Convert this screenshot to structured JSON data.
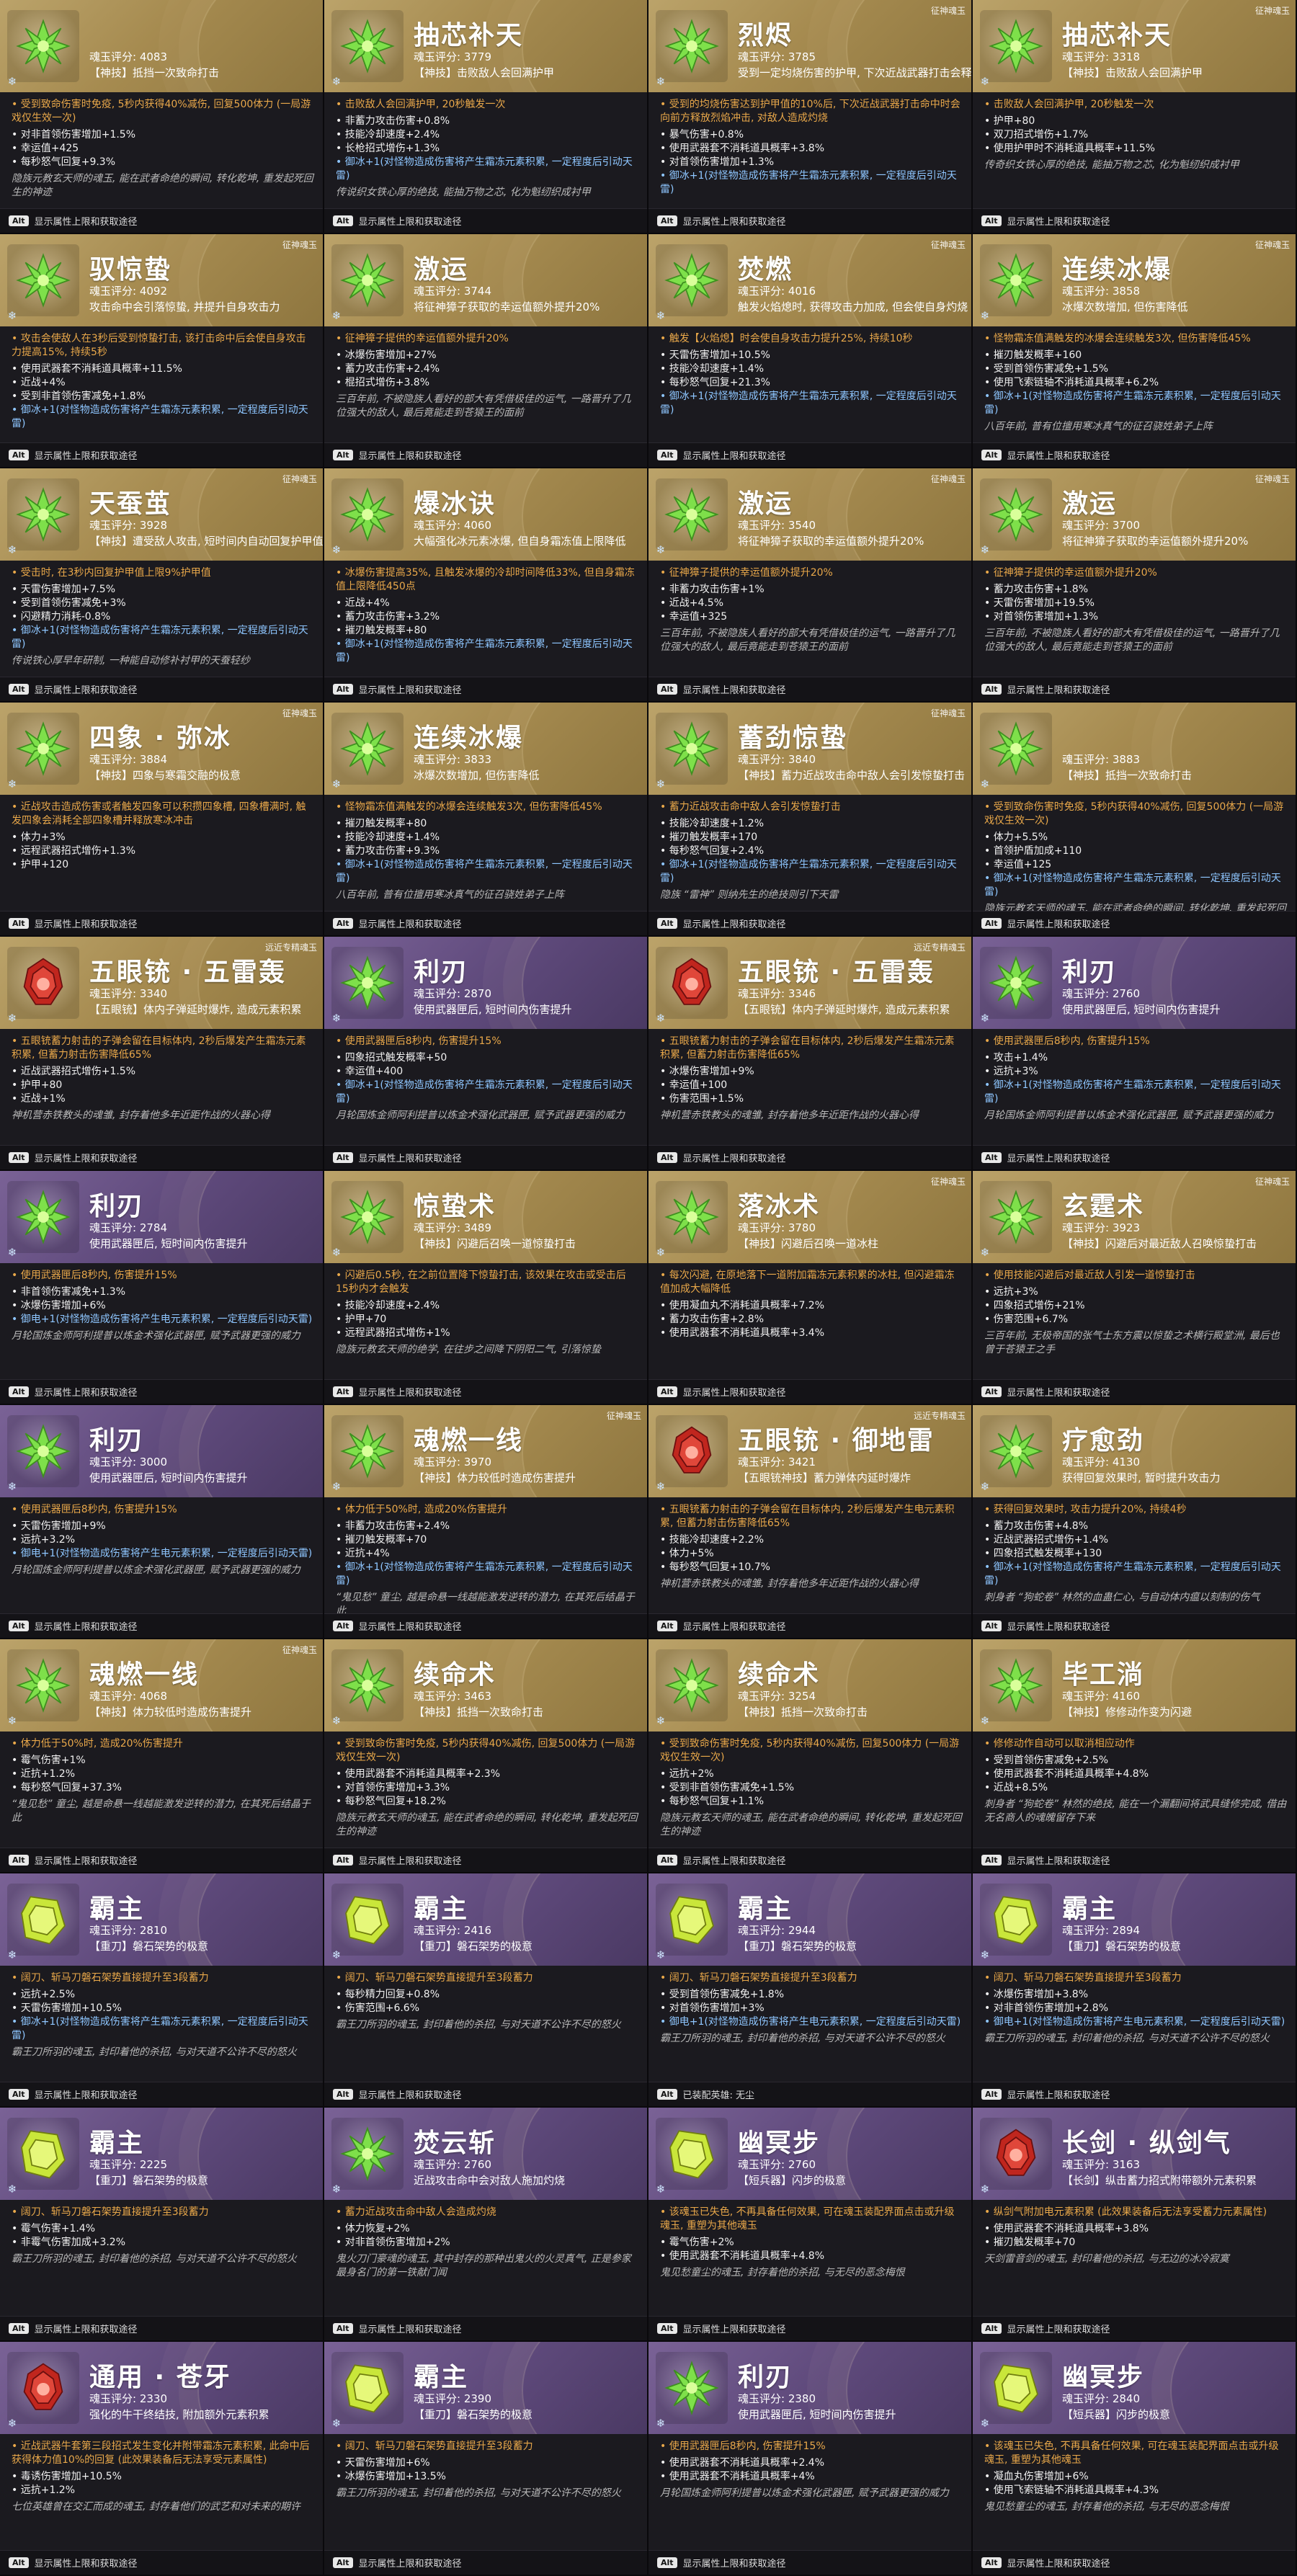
{
  "cards": [
    {
      "name": "",
      "score": "魂玉评分: 4083",
      "skill": "【神技】抵挡一次致命打击",
      "theme": "gold",
      "gem": "green",
      "tag": "",
      "orange": "• 受到致命伤害时免疫, 5秒内获得40%减伤, 回复500体力 (一局游戏仅生效一次)",
      "stats": [
        "• 对非首领伤害增加+1.5%",
        "• 幸运值+425",
        "• 每秒怒气回复+9.3%"
      ],
      "blue": "",
      "desc": "隐族元教玄天师的魂玉, 能在武者命绝的瞬间, 转化乾坤, 重发起死回生的神迹",
      "footer": "显示属性上限和获取途径"
    },
    {
      "name": "抽芯补天",
      "score": "魂玉评分: 3779",
      "skill": "【神技】击败敌人会回满护甲",
      "theme": "gold",
      "gem": "green",
      "tag": "",
      "orange": "• 击败敌人会回满护甲, 20秒触发一次",
      "stats": [
        "• 非蓄力攻击伤害+0.8%",
        "• 技能冷却速度+2.4%",
        "• 长枪招式增伤+1.3%"
      ],
      "blue": "• 御冰+1(对怪物造成伤害将产生霜冻元素积累, 一定程度后引动天雷)",
      "desc": "传说织女铁心厚的绝技, 能抽万物之芯, 化为魁纫织成衬甲",
      "footer": "显示属性上限和获取途径"
    },
    {
      "name": "烈烬",
      "score": "魂玉评分: 3785",
      "skill": "受到一定均烧伤害的护甲, 下次近战武器打击会释放烈燃",
      "theme": "gold",
      "gem": "green",
      "tag": "征神魂玉",
      "orange": "• 受到的均烧伤害达到护甲值的10%后, 下次近战武器打击命中时会向前方释放烈焰冲击, 对敌人造成灼烧",
      "stats": [
        "• 暴气伤害+0.8%",
        "• 使用武器套不消耗道具概率+3.8%",
        "• 对首领伤害增加+1.3%"
      ],
      "blue": "• 御冰+1(对怪物造成伤害将产生霜冻元素积累, 一定程度后引动天雷)",
      "desc": "",
      "footer": "显示属性上限和获取途径"
    },
    {
      "name": "抽芯补天",
      "score": "魂玉评分: 3318",
      "skill": "【神技】击败敌人会回满护甲",
      "theme": "gold",
      "gem": "green",
      "tag": "征神魂玉",
      "orange": "• 击败敌人会回满护甲, 20秒触发一次",
      "stats": [
        "• 护甲+80",
        "• 双刀招式增伤+1.7%",
        "• 使用护甲时不消耗道具概率+11.5%"
      ],
      "blue": "",
      "desc": "传奇织女铁心厚的绝技, 能抽万物之芯, 化为魁纫织成衬甲",
      "footer": "显示属性上限和获取途径"
    },
    {
      "name": "驭惊蛰",
      "score": "魂玉评分: 4092",
      "skill": "攻击命中会引落惊蛰, 并提升自身攻击力",
      "theme": "gold",
      "gem": "green",
      "tag": "征神魂玉",
      "orange": "• 攻击会使敌人在3秒后受到惊蛰打击, 该打击命中后会使自身攻击力提高15%, 持续5秒",
      "stats": [
        "• 使用武器套不消耗道具概率+11.5%",
        "• 近战+4%",
        "• 受到非首领伤害减免+1.8%"
      ],
      "blue": "• 御冰+1(对怪物造成伤害将产生霜冻元素积累, 一定程度后引动天雷)",
      "desc": "",
      "footer": "显示属性上限和获取途径"
    },
    {
      "name": "激运",
      "score": "魂玉评分: 3744",
      "skill": "将征神獐子获取的幸运值额外提升20%",
      "theme": "gold",
      "gem": "green",
      "tag": "",
      "orange": "• 征神獐子提供的幸运值额外提升20%",
      "stats": [
        "• 冰爆伤害增加+27%",
        "• 蓄力攻击伤害+2.4%",
        "• 棍招式增伤+3.8%"
      ],
      "blue": "",
      "desc": "三百年前, 不被隐族人看好的部大有凭借极佳的运气, 一路晋升了几位强大的敌人, 最后竟能走到苍猿王的面前",
      "footer": "显示属性上限和获取途径"
    },
    {
      "name": "焚燃",
      "score": "魂玉评分: 4016",
      "skill": "触发火焰熄时, 获得攻击力加成, 但会使自身灼烧",
      "theme": "gold",
      "gem": "green",
      "tag": "征神魂玉",
      "orange": "• 触发【火焰熄】时会使自身攻击力提升25%, 持续10秒",
      "stats": [
        "• 天雷伤害增加+10.5%",
        "• 技能冷却速度+1.4%",
        "• 每秒怒气回复+21.3%"
      ],
      "blue": "• 御冰+1(对怪物造成伤害将产生霜冻元素积累, 一定程度后引动天雷)",
      "desc": "",
      "footer": "显示属性上限和获取途径"
    },
    {
      "name": "连续冰爆",
      "score": "魂玉评分: 3858",
      "skill": "冰爆次数增加, 但伤害降低",
      "theme": "gold",
      "gem": "green",
      "tag": "征神魂玉",
      "orange": "• 怪物霜冻值满触发的冰爆会连续触发3次, 但伤害降低45%",
      "stats": [
        "• 摧刃触发概率+160",
        "• 受到首领伤害减免+1.5%",
        "• 使用飞索链轴不消耗道具概率+6.2%"
      ],
      "blue": "• 御冰+1(对怪物造成伤害将产生霜冻元素积累, 一定程度后引动天雷)",
      "desc": "八百年前, 普有位擅用寒冰真气的征召骁姓弟子上阵",
      "footer": "显示属性上限和获取途径"
    },
    {
      "name": "天蚕茧",
      "score": "魂玉评分: 3928",
      "skill": "【神技】遭受敌人攻击, 短时间内自动回复护甲值",
      "theme": "gold",
      "gem": "green",
      "tag": "征神魂玉",
      "orange": "• 受击时, 在3秒内回复护甲值上限9%护甲值",
      "stats": [
        "• 天雷伤害增加+7.5%",
        "• 受到首领伤害减免+3%",
        "• 闪避精力消耗-0.8%"
      ],
      "blue": "• 御冰+1(对怪物造成伤害将产生霜冻元素积累, 一定程度后引动天雷)",
      "desc": "传说铁心厚早年研制, 一种能自动修补衬甲的天蚕轻纱",
      "footer": "显示属性上限和获取途径"
    },
    {
      "name": "爆冰诀",
      "score": "魂玉评分: 4060",
      "skill": "大幅强化冰元素冰爆, 但自身霜冻值上限降低",
      "theme": "gold",
      "gem": "green",
      "tag": "",
      "orange": "• 冰爆伤害提高35%, 且触发冰爆的冷却时间降低33%, 但自身霜冻值上限降低450点",
      "stats": [
        "• 近战+4%",
        "• 蓄力攻击伤害+3.2%",
        "• 摧刃触发概率+80"
      ],
      "blue": "• 御冰+1(对怪物造成伤害将产生霜冻元素积累, 一定程度后引动天雷)",
      "desc": "",
      "footer": "显示属性上限和获取途径"
    },
    {
      "name": "激运",
      "score": "魂玉评分: 3540",
      "skill": "将征神獐子获取的幸运值额外提升20%",
      "theme": "gold",
      "gem": "green",
      "tag": "征神魂玉",
      "orange": "• 征神獐子提供的幸运值额外提升20%",
      "stats": [
        "• 非蓄力攻击伤害+1%",
        "• 近战+4.5%",
        "• 幸运值+325"
      ],
      "blue": "",
      "desc": "三百年前, 不被隐族人看好的部大有凭借极佳的运气, 一路晋升了几位强大的敌人, 最后竟能走到苍猿王的面前",
      "footer": "显示属性上限和获取途径"
    },
    {
      "name": "激运",
      "score": "魂玉评分: 3700",
      "skill": "将征神獐子获取的幸运值额外提升20%",
      "theme": "gold",
      "gem": "green",
      "tag": "征神魂玉",
      "orange": "• 征神獐子提供的幸运值额外提升20%",
      "stats": [
        "• 蓄力攻击伤害+1.8%",
        "• 天雷伤害增加+19.5%",
        "• 对首领伤害增加+1.3%"
      ],
      "blue": "",
      "desc": "三百年前, 不被隐族人看好的部大有凭借极佳的运气, 一路晋升了几位强大的敌人, 最后竟能走到苍猿王的面前",
      "footer": "显示属性上限和获取途径"
    },
    {
      "name": "四象 · 弥冰",
      "score": "魂玉评分: 3884",
      "skill": "【神技】四象与寒霜交融的极意",
      "theme": "gold",
      "gem": "green",
      "tag": "征神魂玉",
      "orange": "• 近战攻击造成伤害或者触发四象可以积攒四象槽, 四象槽满时, 触发四象会消耗全部四象槽并释放寒冰冲击",
      "stats": [
        "• 体力+3%",
        "• 远程武器招式增伤+1.3%",
        "• 护甲+120"
      ],
      "blue": "",
      "desc": "",
      "footer": "显示属性上限和获取途径"
    },
    {
      "name": "连续冰爆",
      "score": "魂玉评分: 3833",
      "skill": "冰爆次数增加, 但伤害降低",
      "theme": "gold",
      "gem": "green",
      "tag": "",
      "orange": "• 怪物霜冻值满触发的冰爆会连续触发3次, 但伤害降低45%",
      "stats": [
        "• 摧刃触发概率+80",
        "• 技能冷却速度+1.4%",
        "• 蓄力攻击伤害+9.3%"
      ],
      "blue": "• 御冰+1(对怪物造成伤害将产生霜冻元素积累, 一定程度后引动天雷)",
      "desc": "八百年前, 普有位擅用寒冰真气的征召骁姓弟子上阵",
      "footer": "显示属性上限和获取途径"
    },
    {
      "name": "蓄劲惊蛰",
      "score": "魂玉评分: 3840",
      "skill": "【神技】蓄力近战攻击命中敌人会引发惊蛰打击",
      "theme": "gold",
      "gem": "green",
      "tag": "征神魂玉",
      "orange": "• 蓄力近战攻击命中敌人会引发惊蛰打击",
      "stats": [
        "• 技能冷却速度+1.2%",
        "• 摧刃触发概率+170",
        "• 每秒怒气回复+2.4%"
      ],
      "blue": "• 御冰+1(对怪物造成伤害将产生霜冻元素积累, 一定程度后引动天雷)",
      "desc": "隐族 “雷神” 则纳先生的绝技则引下天雷",
      "footer": "显示属性上限和获取途径"
    },
    {
      "name": "",
      "score": "魂玉评分: 3883",
      "skill": "【神技】抵挡一次致命打击",
      "theme": "gold",
      "gem": "green",
      "tag": "",
      "orange": "• 受到致命伤害时免疫, 5秒内获得40%减伤, 回复500体力 (一局游戏仅生效一次)",
      "stats": [
        "• 体力+5.5%",
        "• 首领护盾加成+110",
        "• 幸运值+125"
      ],
      "blue": "• 御冰+1(对怪物造成伤害将产生霜冻元素积累, 一定程度后引动天雷)",
      "desc": "隐族元教玄天师的魂玉, 能在武者命绝的瞬间, 转化乾坤, 重发起死回生的神迹",
      "footer": "显示属性上限和获取途径"
    },
    {
      "name": "五眼铳 · 五雷轰",
      "score": "魂玉评分: 3340",
      "skill": "【五眼铳】体内子弹延时爆炸, 造成元素积累",
      "theme": "gold",
      "gem": "red",
      "tag": "远近专精魂玉",
      "orange": "• 五眼铳蓄力射击的子弹会留在目标体内, 2秒后爆发产生霜冻元素积累, 但蓄力射击伤害降低65%",
      "stats": [
        "• 近战武器招式增伤+1.5%",
        "• 护甲+80",
        "• 近战+1%"
      ],
      "blue": "",
      "desc": "神机营赤铁教头的魂雏, 封存着他多年近距作战的火器心得",
      "footer": "显示属性上限和获取途径"
    },
    {
      "name": "利刃",
      "score": "魂玉评分: 2870",
      "skill": "使用武器匣后, 短时间内伤害提升",
      "theme": "purple",
      "gem": "green",
      "tag": "",
      "orange": "• 使用武器匣后8秒内, 伤害提升15%",
      "stats": [
        "• 四象招式触发概率+50",
        "• 幸运值+400"
      ],
      "blue": "• 御冰+1(对怪物造成伤害将产生霜冻元素积累, 一定程度后引动天雷)",
      "desc": "月轮国炼金师阿利提普以炼金术强化武器匣, 赋予武器更强的威力",
      "footer": "显示属性上限和获取途径"
    },
    {
      "name": "五眼铳 · 五雷轰",
      "score": "魂玉评分: 3346",
      "skill": "【五眼铳】体内子弹延时爆炸, 造成元素积累",
      "theme": "gold",
      "gem": "red",
      "tag": "远近专精魂玉",
      "orange": "• 五眼铳蓄力射击的子弹会留在目标体内, 2秒后爆发产生霜冻元素积累, 但蓄力射击伤害降低65%",
      "stats": [
        "• 冰爆伤害增加+9%",
        "• 幸运值+100",
        "• 伤害范围+1.5%"
      ],
      "blue": "",
      "desc": "神机营赤铁教头的魂雏, 封存着他多年近距作战的火器心得",
      "footer": "显示属性上限和获取途径"
    },
    {
      "name": "利刃",
      "score": "魂玉评分: 2760",
      "skill": "使用武器匣后, 短时间内伤害提升",
      "theme": "purple",
      "gem": "green",
      "tag": "",
      "orange": "• 使用武器匣后8秒内, 伤害提升15%",
      "stats": [
        "• 攻击+1.4%",
        "• 远抗+3%"
      ],
      "blue": "• 御冰+1(对怪物造成伤害将产生霜冻元素积累, 一定程度后引动天雷)",
      "desc": "月轮国炼金师阿利提普以炼金术强化武器匣, 赋予武器更强的威力",
      "footer": "显示属性上限和获取途径"
    },
    {
      "name": "利刃",
      "score": "魂玉评分: 2784",
      "skill": "使用武器匣后, 短时间内伤害提升",
      "theme": "purple",
      "gem": "green",
      "tag": "",
      "orange": "• 使用武器匣后8秒内, 伤害提升15%",
      "stats": [
        "• 非首领伤害减免+1.3%",
        "• 冰爆伤害增加+6%"
      ],
      "blue": "• 御电+1(对怪物造成伤害将产生电元素积累, 一定程度后引动天雷)",
      "desc": "月轮国炼金师阿利提普以炼金术强化武器匣, 赋予武器更强的威力",
      "footer": "显示属性上限和获取途径"
    },
    {
      "name": "惊蛰术",
      "score": "魂玉评分: 3489",
      "skill": "【神技】闪避后召唤一道惊蛰打击",
      "theme": "gold",
      "gem": "green",
      "tag": "",
      "orange": "• 闪避后0.5秒, 在之前位置降下惊蛰打击, 该效果在攻击或受击后15秒内才会触发",
      "stats": [
        "• 技能冷却速度+2.4%",
        "• 护甲+70",
        "• 远程武器招式增伤+1%"
      ],
      "blue": "",
      "desc": "隐族元教玄天师的绝学, 在往步之间降下阴阳二气, 引落惊蛰",
      "footer": "显示属性上限和获取途径"
    },
    {
      "name": "落冰术",
      "score": "魂玉评分: 3780",
      "skill": "【神技】闪避后召唤一道冰柱",
      "theme": "gold",
      "gem": "green",
      "tag": "征神魂玉",
      "orange": "• 每次闪避, 在原地落下一道附加霜冻元素积累的冰柱, 但闪避霜冻值加成大幅降低",
      "stats": [
        "• 使用凝血丸不消耗道具概率+7.2%",
        "• 蓄力攻击伤害+2.8%",
        "• 使用武器套不消耗道具概率+3.4%"
      ],
      "blue": "",
      "desc": "",
      "footer": "显示属性上限和获取途径"
    },
    {
      "name": "玄霆术",
      "score": "魂玉评分: 3923",
      "skill": "【神技】闪避后对最近敌人召唤惊蛰打击",
      "theme": "gold",
      "gem": "green",
      "tag": "征神魂玉",
      "orange": "• 使用技能闪避后对最近敌人引发一道惊蛰打击",
      "stats": [
        "• 远抗+3%",
        "• 四象招式增伤+21%",
        "• 伤害范围+6.7%"
      ],
      "blue": "",
      "desc": "三百年前, 无极帝国的张气士东方震以惊蛰之术横行殿堂洲, 最后也曾于苍猿王之手",
      "footer": "显示属性上限和获取途径"
    },
    {
      "name": "利刃",
      "score": "魂玉评分: 3000",
      "skill": "使用武器匣后, 短时间内伤害提升",
      "theme": "purple",
      "gem": "green",
      "tag": "",
      "orange": "• 使用武器匣后8秒内, 伤害提升15%",
      "stats": [
        "• 天雷伤害增加+9%",
        "• 远抗+3.2%"
      ],
      "blue": "• 御电+1(对怪物造成伤害将产生电元素积累, 一定程度后引动天雷)",
      "desc": "月轮国炼金师阿利提普以炼金术强化武器匣, 赋予武器更强的威力",
      "footer": "显示属性上限和获取途径"
    },
    {
      "name": "魂燃一线",
      "score": "魂玉评分: 3970",
      "skill": "【神技】体力较低时造成伤害提升",
      "theme": "gold",
      "gem": "green",
      "tag": "征神魂玉",
      "orange": "• 体力低于50%时, 造成20%伤害提升",
      "stats": [
        "• 非蓄力攻击伤害+2.4%",
        "• 摧刃触发概率+70",
        "• 近抗+4%"
      ],
      "blue": "• 御冰+1(对怪物造成伤害将产生霜冻元素积累, 一定程度后引动天雷)",
      "desc": "“鬼见愁” 童尘, 越是命悬一线越能激发逆转的潜力, 在其死后结晶于此",
      "footer": "显示属性上限和获取途径"
    },
    {
      "name": "五眼铳 · 御地雷",
      "score": "魂玉评分: 3421",
      "skill": "【五眼铳神技】蓄力弹体内延时爆炸",
      "theme": "gold",
      "gem": "red",
      "tag": "远近专精魂玉",
      "orange": "• 五眼铳蓄力射击的子弹会留在目标体内, 2秒后爆发产生电元素积累, 但蓄力射击伤害降低65%",
      "stats": [
        "• 技能冷却速度+2.2%",
        "• 体力+5%",
        "• 每秒怒气回复+10.7%"
      ],
      "blue": "",
      "desc": "神机营赤铁教头的魂雏, 封存着他多年近距作战的火器心得",
      "footer": "显示属性上限和获取途径"
    },
    {
      "name": "疗愈劲",
      "score": "魂玉评分: 4130",
      "skill": "获得回复效果时, 暂时提升攻击力",
      "theme": "gold",
      "gem": "green",
      "tag": "",
      "orange": "• 获得回复效果时, 攻击力提升20%, 持续4秒",
      "stats": [
        "• 蓄力攻击伤害+4.8%",
        "• 近战武器招式增伤+1.4%",
        "• 四象招式触发概率+130"
      ],
      "blue": "• 御冰+1(对怪物造成伤害将产生霜冻元素积累, 一定程度后引动天雷)",
      "desc": "刺身者 “狗蛇卷” 林然的血蛊仁心, 与自动体内瘟以刻制的伤气",
      "footer": "显示属性上限和获取途径"
    },
    {
      "name": "魂燃一线",
      "score": "魂玉评分: 4068",
      "skill": "【神技】体力较低时造成伤害提升",
      "theme": "gold",
      "gem": "green",
      "tag": "征神魂玉",
      "orange": "• 体力低于50%时, 造成20%伤害提升",
      "stats": [
        "• 霉气伤害+1%",
        "• 近抗+1.2%",
        "• 每秒怒气回复+37.3%"
      ],
      "blue": "",
      "desc": "“鬼见愁” 童尘, 越是命悬一线越能激发逆转的潜力, 在其死后结晶于此",
      "footer": "显示属性上限和获取途径"
    },
    {
      "name": "续命术",
      "score": "魂玉评分: 3463",
      "skill": "【神技】抵挡一次致命打击",
      "theme": "gold",
      "gem": "green",
      "tag": "",
      "orange": "• 受到致命伤害时免疫, 5秒内获得40%减伤, 回复500体力 (一局游戏仅生效一次)",
      "stats": [
        "• 使用武器套不消耗道具概率+2.3%",
        "• 对首领伤害增加+3.3%",
        "• 每秒怒气回复+18.2%"
      ],
      "blue": "",
      "desc": "隐族元教玄天师的魂玉, 能在武者命绝的瞬间, 转化乾坤, 重发起死回生的神迹",
      "footer": "显示属性上限和获取途径"
    },
    {
      "name": "续命术",
      "score": "魂玉评分: 3254",
      "skill": "【神技】抵挡一次致命打击",
      "theme": "gold",
      "gem": "green",
      "tag": "",
      "orange": "• 受到致命伤害时免疫, 5秒内获得40%减伤, 回复500体力 (一局游戏仅生效一次)",
      "stats": [
        "• 远抗+2%",
        "• 受到非首领伤害减免+1.5%",
        "• 每秒怒气回复+1.1%"
      ],
      "blue": "",
      "desc": "隐族元教玄天师的魂玉, 能在武者命绝的瞬间, 转化乾坤, 重发起死回生的神迹",
      "footer": "显示属性上限和获取途径"
    },
    {
      "name": "毕工淌",
      "score": "魂玉评分: 4160",
      "skill": "【神技】修修动作变为闪避",
      "theme": "gold",
      "gem": "green",
      "tag": "",
      "orange": "• 修修动作自动可以取消相应动作",
      "stats": [
        "• 受到首领伤害减免+2.5%",
        "• 使用武器套不消耗道具概率+4.8%",
        "• 近战+8.5%"
      ],
      "blue": "",
      "desc": "刺身者 “狗蛇卷” 林然的绝技, 能在一个漏翻间将武具缝修完成, 借由无名商人的魂魄留存下来",
      "footer": "显示属性上限和获取途径"
    },
    {
      "name": "霸主",
      "score": "魂玉评分: 2810",
      "skill": "【重刀】磐石架势的极意",
      "theme": "purple",
      "gem": "yellow",
      "tag": "",
      "orange": "• 阔刀、斩马刀磐石架势直接提升至3段蓄力",
      "stats": [
        "• 远抗+2.5%",
        "• 天雷伤害增加+10.5%"
      ],
      "blue": "• 御冰+1(对怪物造成伤害将产生霜冻元素积累, 一定程度后引动天雷)",
      "desc": "霸王刀所羽的魂玉, 封印着他的杀招, 与对天道不公许不尽的怒火",
      "footer": "显示属性上限和获取途径"
    },
    {
      "name": "霸主",
      "score": "魂玉评分: 2416",
      "skill": "【重刀】磐石架势的极意",
      "theme": "purple",
      "gem": "yellow",
      "tag": "",
      "orange": "• 阔刀、斩马刀磐石架势直接提升至3段蓄力",
      "stats": [
        "• 每秒精力回复+0.8%",
        "• 伤害范围+6.6%"
      ],
      "blue": "",
      "desc": "霸王刀所羽的魂玉, 封印着他的杀招, 与对天道不公许不尽的怒火",
      "footer": "显示属性上限和获取途径"
    },
    {
      "name": "霸主",
      "score": "魂玉评分: 2944",
      "skill": "【重刀】磐石架势的极意",
      "theme": "purple",
      "gem": "yellow",
      "tag": "",
      "orange": "• 阔刀、斩马刀磐石架势直接提升至3段蓄力",
      "stats": [
        "• 受到首领伤害减免+1.8%",
        "• 对首领伤害增加+3%"
      ],
      "blue": "• 御电+1(对怪物造成伤害将产生电元素积累, 一定程度后引动天雷)",
      "desc": "霸王刀所羽的魂玉, 封印着他的杀招, 与对天道不公许不尽的怒火",
      "footer": "已装配英雄: 无尘"
    },
    {
      "name": "霸主",
      "score": "魂玉评分: 2894",
      "skill": "【重刀】磐石架势的极意",
      "theme": "purple",
      "gem": "yellow",
      "tag": "",
      "orange": "• 阔刀、斩马刀磐石架势直接提升至3段蓄力",
      "stats": [
        "• 冰爆伤害增加+3.8%",
        "• 对非首领伤害增加+2.8%"
      ],
      "blue": "• 御电+1(对怪物造成伤害将产生电元素积累, 一定程度后引动天雷)",
      "desc": "霸王刀所羽的魂玉, 封印着他的杀招, 与对天道不公许不尽的怒火",
      "footer": "显示属性上限和获取途径"
    },
    {
      "name": "霸主",
      "score": "魂玉评分: 2225",
      "skill": "【重刀】磐石架势的极意",
      "theme": "purple",
      "gem": "yellow",
      "tag": "",
      "orange": "• 阔刀、斩马刀磐石架势直接提升至3段蓄力",
      "stats": [
        "• 霉气伤害+1.4%",
        "• 非霉气伤害加成+3.2%"
      ],
      "blue": "",
      "desc": "霸王刀所羽的魂玉, 封印着他的杀招, 与对天道不公许不尽的怒火",
      "footer": "显示属性上限和获取途径"
    },
    {
      "name": "焚云斩",
      "score": "魂玉评分: 2760",
      "skill": "近战攻击命中会对敌人施加灼烧",
      "theme": "purple",
      "gem": "green",
      "tag": "",
      "orange": "• 蓄力近战攻击命中敌人会造成灼烧",
      "stats": [
        "• 体力恢复+2%",
        "• 对非首领伤害增加+2%"
      ],
      "blue": "",
      "desc": "鬼火刀门豪魂的魂玉, 其中封存的那种出鬼火的火灵真气, 正是参家最身名门的第一铁献门闻",
      "footer": "显示属性上限和获取途径"
    },
    {
      "name": "幽冥步",
      "score": "魂玉评分: 2760",
      "skill": "【短兵器】闪步的极意",
      "theme": "purple",
      "gem": "yellow",
      "tag": "",
      "orange": "• 该魂玉已失色, 不再具备任何效果, 可在魂玉装配界面点击或升级魂玉, 重塑为其他魂玉",
      "stats": [
        "• 霉气伤害+2%",
        "• 使用武器套不消耗道具概率+4.8%"
      ],
      "blue": "",
      "desc": "鬼见愁童尘的魂玉, 封存着他的杀招, 与无尽的恶念梅恨",
      "footer": "显示属性上限和获取途径"
    },
    {
      "name": "长剑 · 纵剑气",
      "score": "魂玉评分: 3163",
      "skill": "【长剑】纵击蓄力招式附带额外元素积累",
      "theme": "purple",
      "gem": "red",
      "tag": "",
      "orange": "• 纵剑气附加电元素积累 (此效果装备后无法享受蓄力元素属性)",
      "stats": [
        "• 使用武器套不消耗道具概率+3.8%",
        "• 摧刃触发概率+70"
      ],
      "blue": "",
      "desc": "天剑雷音剑的魂玉, 封印着他的杀招, 与无边的冰冷寂寞",
      "footer": "显示属性上限和获取途径"
    },
    {
      "name": "通用 · 苍牙",
      "score": "魂玉评分: 2330",
      "skill": "强化的牛干终结技, 附加额外元素积累",
      "theme": "purple",
      "gem": "red",
      "tag": "",
      "orange": "• 近战武器牛套第三段招式发生变化并附带霜冻元素积累, 此命中后获得体力值10%的回复 (此效果装备后无法享受元素属性)",
      "stats": [
        "• 毒诱伤害增加+10.5%",
        "• 远抗+1.2%"
      ],
      "blue": "",
      "desc": "七位英雄曾在交汇而成的魂玉, 封存着他们的武艺和对未来的期许",
      "footer": "显示属性上限和获取途径"
    },
    {
      "name": "霸主",
      "score": "魂玉评分: 2390",
      "skill": "【重刀】磐石架势的极意",
      "theme": "purple",
      "gem": "yellow",
      "tag": "",
      "orange": "• 阔刀、斩马刀磐石架势直接提升至3段蓄力",
      "stats": [
        "• 天雷伤害增加+6%",
        "• 冰爆伤害增加+13.5%"
      ],
      "blue": "",
      "desc": "霸王刀所羽的魂玉, 封印着他的杀招, 与对天道不公许不尽的怒火",
      "footer": "显示属性上限和获取途径"
    },
    {
      "name": "利刃",
      "score": "魂玉评分: 2380",
      "skill": "使用武器匣后, 短时间内伤害提升",
      "theme": "purple",
      "gem": "green",
      "tag": "",
      "orange": "• 使用武器匣后8秒内, 伤害提升15%",
      "stats": [
        "• 使用武器套不消耗道具概率+2.4%",
        "• 使用武器套不消耗道具概率+4%"
      ],
      "blue": "",
      "desc": "月轮国炼金师阿利提普以炼金术强化武器匣, 赋予武器更强的威力",
      "footer": "显示属性上限和获取途径"
    },
    {
      "name": "幽冥步",
      "score": "魂玉评分: 2840",
      "skill": "【短兵器】闪步的极意",
      "theme": "purple",
      "gem": "yellow",
      "tag": "",
      "orange": "• 该魂玉已失色, 不再具备任何效果, 可在魂玉装配界面点击或升级魂玉, 重塑为其他魂玉",
      "stats": [
        "• 凝血丸伤害增加+6%",
        "• 使用飞索链轴不消耗道具概率+4.3%"
      ],
      "blue": "",
      "desc": "鬼见愁童尘的魂玉, 封存着他的杀招, 与无尽的恶念梅恨",
      "footer": "显示属性上限和获取途径"
    }
  ],
  "ui": {
    "alt_key": "Alt"
  },
  "colors": {
    "gold_header": "#a68b50",
    "purple_header": "#5f4a7c",
    "orange_text": "#e9a84a",
    "blue_text": "#8ec6ff",
    "body_bg": "#1b1a1f"
  }
}
